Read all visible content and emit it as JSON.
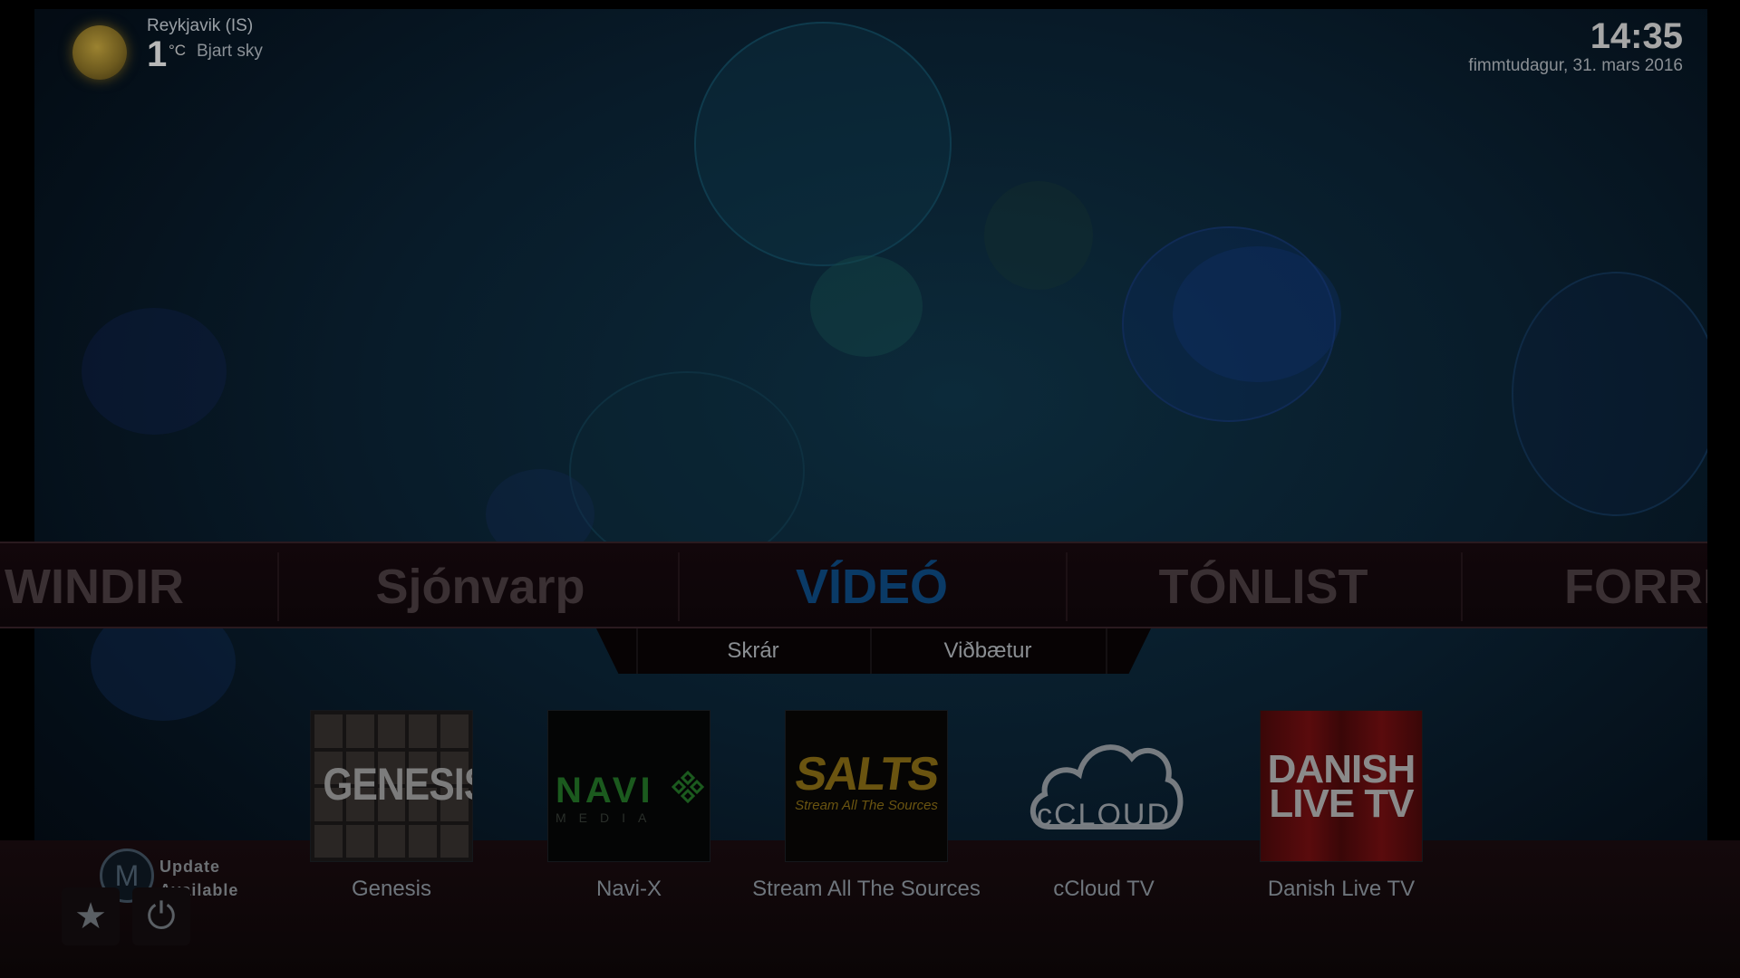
{
  "weather": {
    "icon": "sun-icon",
    "city": "Reykjavik (IS)",
    "temperature": "1",
    "unit": "°C",
    "condition": "Bjart sky"
  },
  "clock": {
    "time": "14:35",
    "date": "fimmtudagur, 31. mars 2016"
  },
  "main_menu": {
    "items": [
      {
        "label": "INDIR",
        "partial_prefix": "W"
      },
      {
        "label": "Sjónvarp"
      },
      {
        "label": "VÍDEÓ",
        "active": true
      },
      {
        "label": "TÓNLIST"
      },
      {
        "label": "FORRIT"
      }
    ]
  },
  "submenu": {
    "items": [
      {
        "label": "Skrár"
      },
      {
        "label": "Viðbætur"
      }
    ]
  },
  "addons": [
    {
      "label": "Genesis",
      "thumb_text": "GENESIS"
    },
    {
      "label": "Navi-X",
      "thumb_text": "NAVI",
      "thumb_subtext": "MEDIA"
    },
    {
      "label": "Stream All The Sources",
      "thumb_text": "SALTS",
      "thumb_subtext": "Stream All The Sources"
    },
    {
      "label": "cCloud TV",
      "thumb_text": "cCLOUD"
    },
    {
      "label": "Danish Live TV",
      "thumb_text_line1": "DANISH",
      "thumb_text_line2": "LIVE TV"
    }
  ],
  "update": {
    "line1": "Update",
    "line2": "Available",
    "logo_letter": "M"
  },
  "footer_buttons": [
    {
      "icon": "star-icon",
      "glyph": "★"
    },
    {
      "icon": "power-icon",
      "glyph": "⏻"
    }
  ],
  "edge_arrow": {
    "glyph": "K"
  },
  "colors": {
    "accent": "#0a3a66",
    "menu_inactive": "#3a3033",
    "text": "#8a8e92"
  }
}
